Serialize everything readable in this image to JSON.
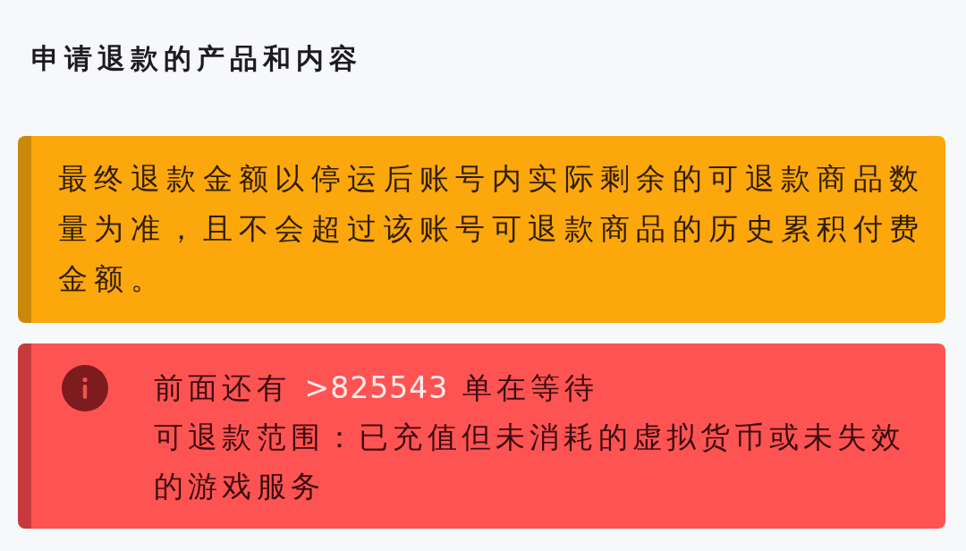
{
  "title": "申请退款的产品和内容",
  "notices": [
    {
      "kind": "warning",
      "text": "最终退款金额以停运后账号内实际剩余的可退款商品数量为准，且不会超过该账号可退款商品的历史累积付费金额。"
    },
    {
      "kind": "error",
      "queue_prefix": "前面还有",
      "queue_count": ">825543",
      "queue_suffix": "单在等待",
      "text": "可退款范围：已充值但未消耗的虚拟货币或未失效的游戏服务"
    }
  ]
}
